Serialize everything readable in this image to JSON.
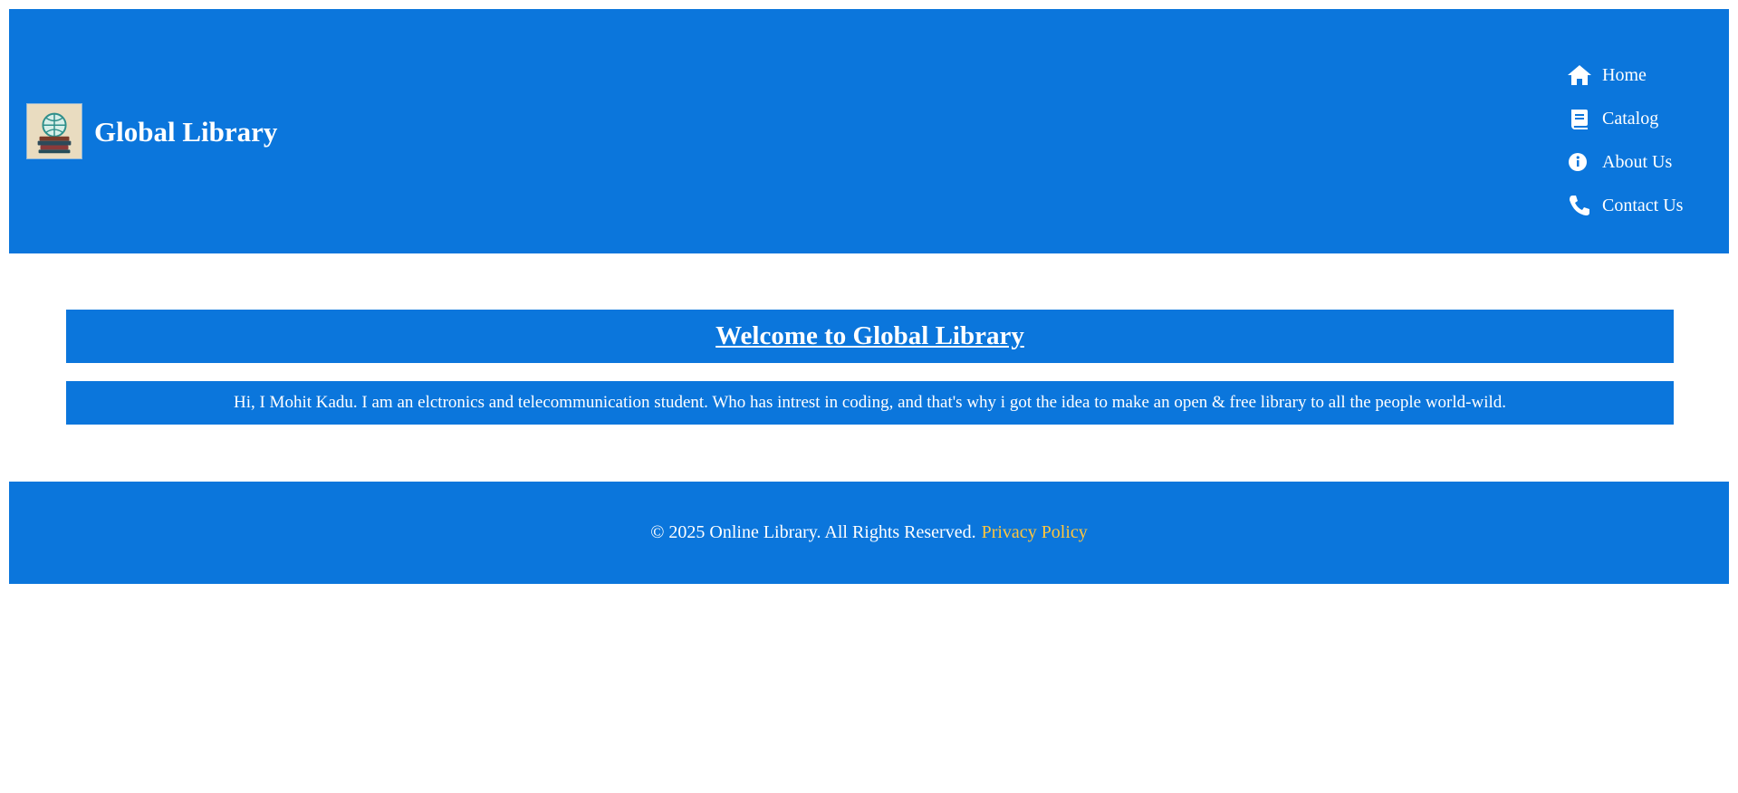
{
  "header": {
    "title": "Global Library",
    "logo_icon": "globe-books-logo"
  },
  "nav": {
    "items": [
      {
        "label": "Home",
        "icon": "home-icon"
      },
      {
        "label": "Catalog",
        "icon": "book-icon"
      },
      {
        "label": "About Us",
        "icon": "info-icon"
      },
      {
        "label": "Contact Us",
        "icon": "phone-icon"
      }
    ]
  },
  "main": {
    "welcome_heading": "Welcome to Global Library",
    "intro_text": "Hi, I Mohit Kadu. I am an elctronics and telecommunication student. Who has intrest in coding, and that's why i got the idea to make an open & free library to all the people world-wild."
  },
  "footer": {
    "copyright": "© 2025 Online Library. All Rights Reserved.",
    "privacy_link": "Privacy Policy"
  },
  "colors": {
    "primary": "#0b76dc",
    "text": "#ffffff",
    "link_accent": "#ffc53d"
  }
}
